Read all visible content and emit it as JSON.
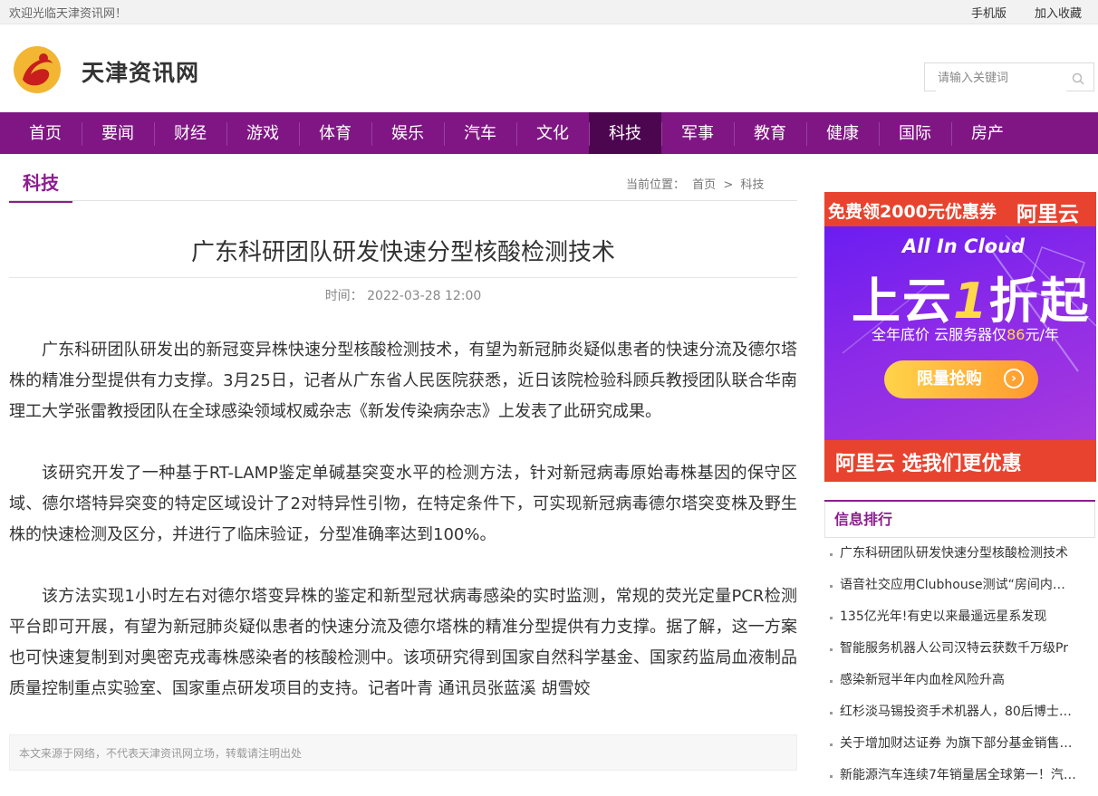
{
  "topbar": {
    "welcome": "欢迎光临天津资讯网！",
    "mobile": "手机版",
    "favorite": "加入收藏"
  },
  "header": {
    "logo_text": "天津资讯网",
    "search_placeholder": "请输入关键词"
  },
  "nav": {
    "items": [
      "首页",
      "要闻",
      "财经",
      "游戏",
      "体育",
      "娱乐",
      "汽车",
      "文化",
      "科技",
      "军事",
      "教育",
      "健康",
      "国际",
      "房产"
    ],
    "active": "科技"
  },
  "section": {
    "title": "科技",
    "breadcrumb_label": "当前位置：",
    "breadcrumb_home": "首页",
    "breadcrumb_sep": ">",
    "breadcrumb_current": "科技"
  },
  "article": {
    "title": "广东科研团队研发快速分型核酸检测技术",
    "time_label": "时间：",
    "time": "2022-03-28 12:00",
    "paragraphs": [
      "广东科研团队研发出的新冠变异株快速分型核酸检测技术，有望为新冠肺炎疑似患者的快速分流及德尔塔株的精准分型提供有力支撑。3月25日，记者从广东省人民医院获悉，近日该院检验科顾兵教授团队联合华南理工大学张雷教授团队在全球感染领域权威杂志《新发传染病杂志》上发表了此研究成果。",
      "该研究开发了一种基于RT-LAMP鉴定单碱基突变水平的检测方法，针对新冠病毒原始毒株基因的保守区域、德尔塔特异突变的特定区域设计了2对特异性引物，在特定条件下，可实现新冠病毒德尔塔突变株及野生株的快速检测及区分，并进行了临床验证，分型准确率达到100%。",
      "该方法实现1小时左右对德尔塔变异株的鉴定和新型冠状病毒感染的实时监测，常规的荧光定量PCR检测平台即可开展，有望为新冠肺炎疑似患者的快速分流及德尔塔株的精准分型提供有力支撑。据了解，这一方案也可快速复制到对奥密克戎毒株感染者的核酸检测中。该项研究得到国家自然科学基金、国家药监局血液制品质量控制重点实验室、国家重点研发项目的支持。记者叶青 通讯员张蓝溪 胡雪姣"
    ],
    "notice": "本文来源于网络，不代表天津资讯网立场，转载请注明出处"
  },
  "ad": {
    "top_left": "免费领2000元优惠券",
    "top_right": "阿里云",
    "headline_tag": "All In Cloud",
    "big_pre": "上云",
    "big_hl": "1",
    "big_post": "折起",
    "sub": "全年底价  云服务器仅",
    "sub_price": "86",
    "sub_unit": "元/年",
    "button": "限量抢购",
    "bottom": "阿里云  选我们更优惠",
    "colors": {
      "red": "#e8432f",
      "purple": "#7a22ee",
      "yellow": "#ffd84a"
    }
  },
  "ranking": {
    "title": "信息排行",
    "items": [
      "广东科研团队研发快速分型核酸检测技术",
      "语音社交应用Clubhouse测试“房间内…",
      "135亿光年!有史以来最遥远星系发现",
      "智能服务机器人公司汉特云获数千万级Pr",
      "感染新冠半年内血栓风险升高",
      "红杉淡马锡投资手术机器人，80后博士…",
      "关于增加财达证券 为旗下部分基金销售…",
      "新能源汽车连续7年销量居全球第一！汽…"
    ]
  },
  "colors": {
    "brand": "#7f1684",
    "nav_active": "#4c0650"
  }
}
